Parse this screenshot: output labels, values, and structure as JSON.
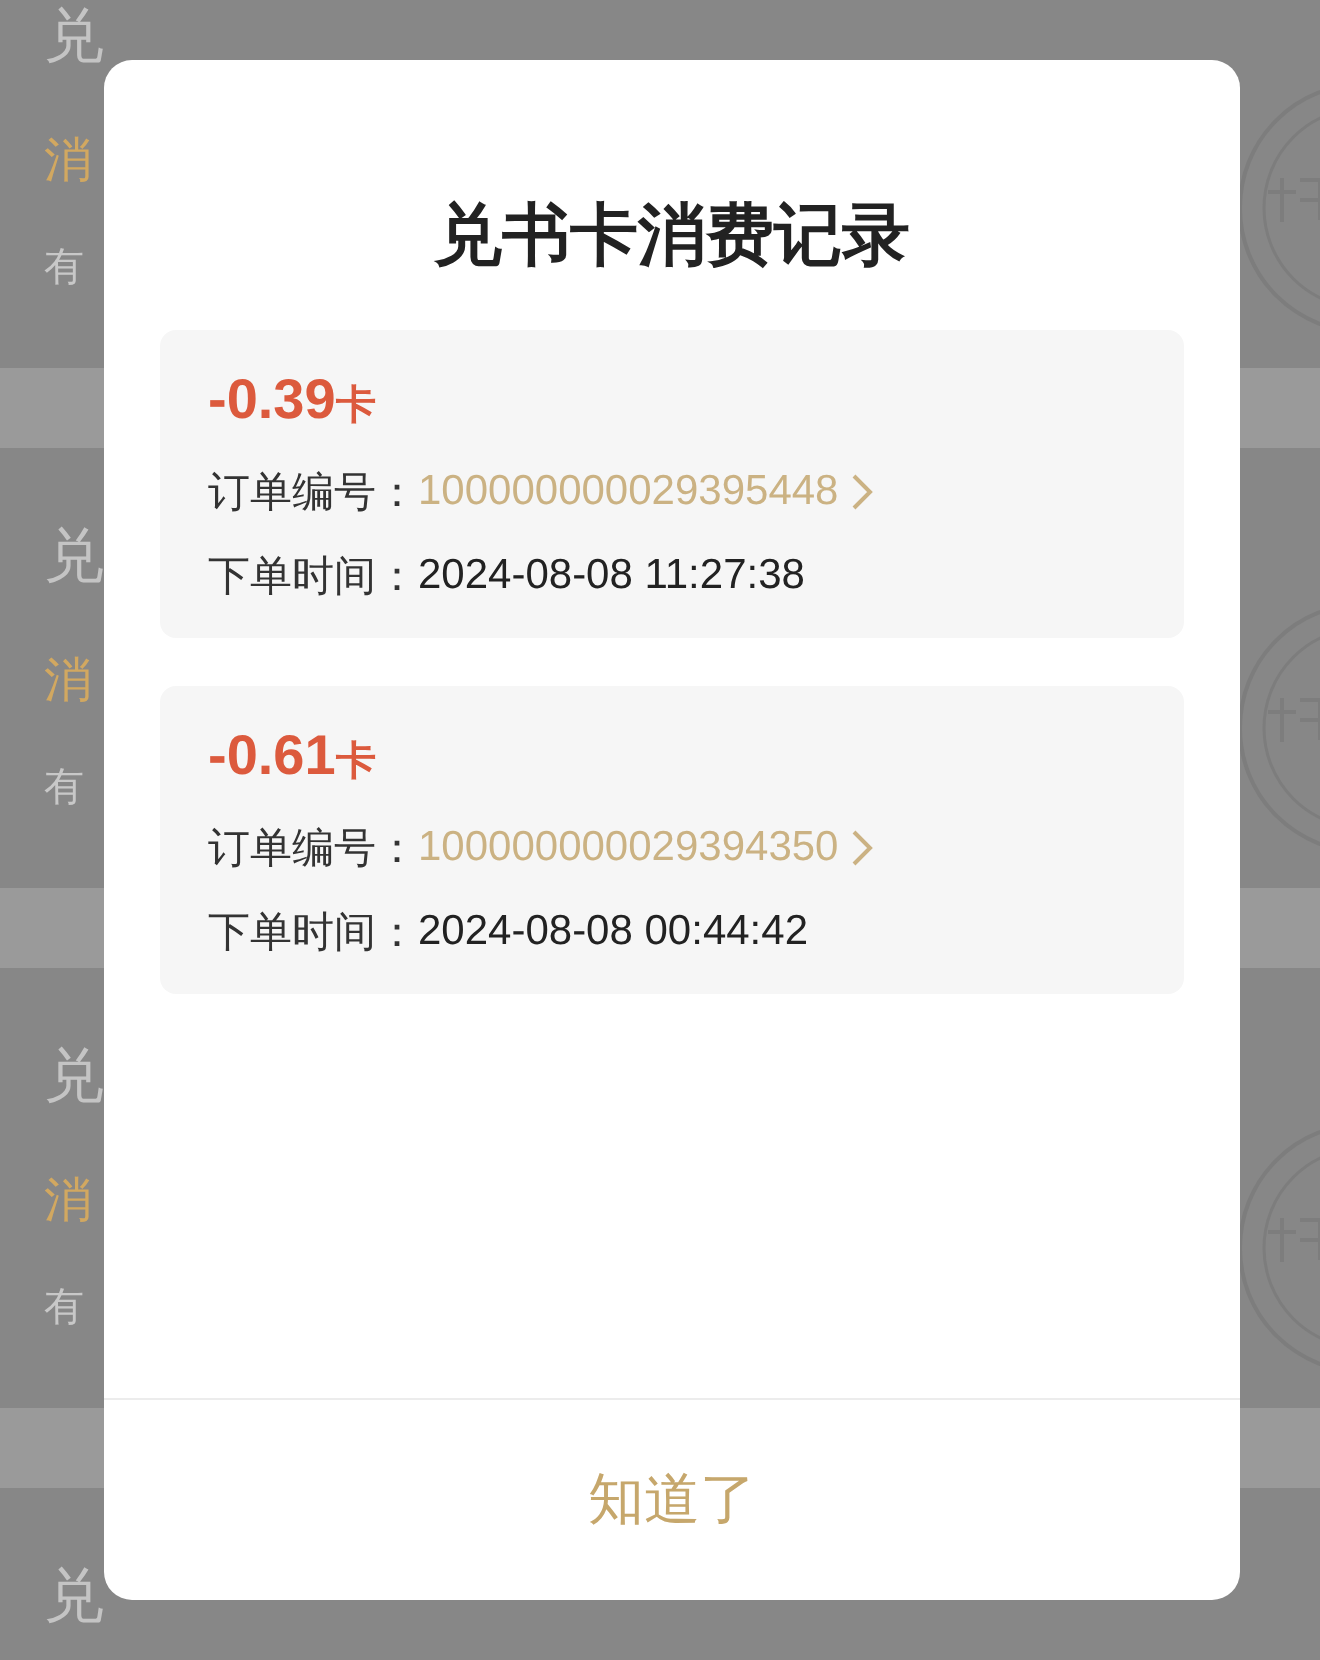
{
  "background_cards": [
    {
      "title": "兑",
      "label": "消",
      "info": "有",
      "stamped": true
    },
    {
      "title": "兑",
      "label": "消",
      "info": "有",
      "stamped": true
    },
    {
      "title": "兑",
      "label": "消",
      "info": "有",
      "stamped": true
    },
    {
      "title": "兑",
      "stamped": false
    }
  ],
  "dialog": {
    "title": "兑书卡消费记录",
    "records": [
      {
        "amount": "-0.39",
        "unit": "卡",
        "order_label": "订单编号：",
        "order_number": "100000000029395448",
        "time_label": "下单时间：",
        "time": "2024-08-08 11:27:38"
      },
      {
        "amount": "-0.61",
        "unit": "卡",
        "order_label": "订单编号：",
        "order_number": "100000000029394350",
        "time_label": "下单时间：",
        "time": "2024-08-08 00:44:42"
      }
    ],
    "button": "知道了"
  }
}
